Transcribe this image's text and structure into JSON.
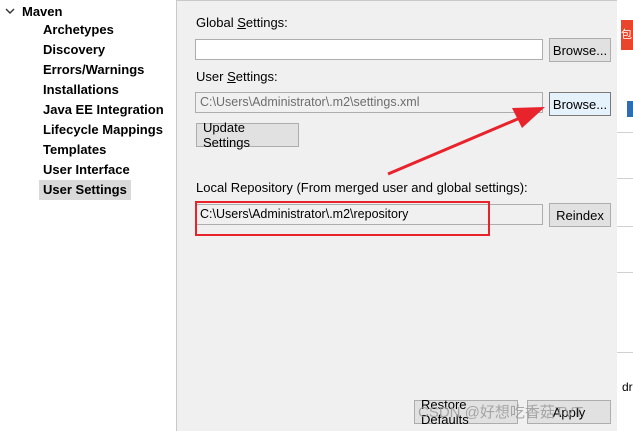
{
  "tree": {
    "root_label": "Maven",
    "items": [
      {
        "label": "Archetypes",
        "selected": false
      },
      {
        "label": "Discovery",
        "selected": false
      },
      {
        "label": "Errors/Warnings",
        "selected": false
      },
      {
        "label": "Installations",
        "selected": false
      },
      {
        "label": "Java EE Integration",
        "selected": false
      },
      {
        "label": "Lifecycle Mappings",
        "selected": false
      },
      {
        "label": "Templates",
        "selected": false
      },
      {
        "label": "User Interface",
        "selected": false
      },
      {
        "label": "User Settings",
        "selected": true
      }
    ]
  },
  "settings": {
    "global_label_pre": "Global ",
    "global_label_u": "S",
    "global_label_post": "ettings:",
    "global_value": "",
    "global_browse": "Browse...",
    "user_label_pre": "User ",
    "user_label_u": "S",
    "user_label_post": "ettings:",
    "user_value": "C:\\Users\\Administrator\\.m2\\settings.xml",
    "user_browse": "Browse...",
    "update_button": "Update Settings",
    "local_repo_label": "Local Repository (From merged user and global settings):",
    "local_repo_value": "C:\\Users\\Administrator\\.m2\\repository",
    "reindex_button": "Reindex",
    "restore_defaults_button": "Restore Defaults",
    "apply_button": "Apply"
  },
  "edge": {
    "red_fragment": "包",
    "text_fragment": "dr"
  },
  "watermark": "CSDN @好想吃香菇TVT",
  "colors": {
    "annotation_red": "#e8232b",
    "panel_bg": "#f0f0f0",
    "selection_bg": "#d9d9d9"
  }
}
